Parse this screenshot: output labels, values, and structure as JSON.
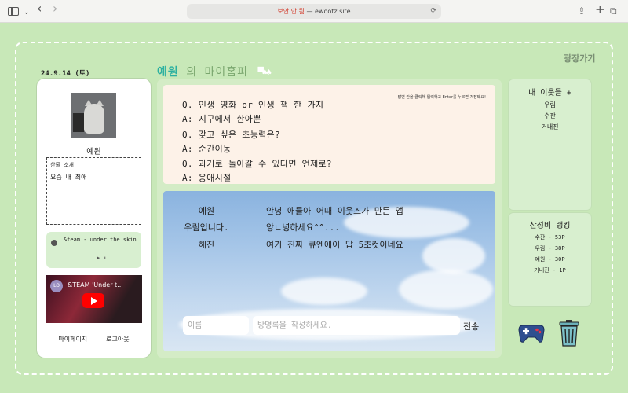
{
  "browser": {
    "url_warning": "보안 안 됨",
    "url_separator": " — ",
    "url_host": "ewootz.site",
    "back_glyph": "‹",
    "forward_glyph": "›",
    "share_glyph": "⇪",
    "new_tab_glyph": "+",
    "tabs_glyph": "⧉"
  },
  "header": {
    "date": "24.9.14 (토)",
    "owner": "예원",
    "title_suffix": " 의 마이홈피 ",
    "plaza_link": "광장가기"
  },
  "profile": {
    "name": "예원",
    "bio_label": "한줄 소개",
    "bio_text": "요즘 내 최애",
    "song": "&team - under the skin",
    "player_controls": "▶ ⏸",
    "video_channel": "LO",
    "video_title": "&TEAM 'Under t...",
    "mypage_link": "마이페이지",
    "logout_link": "로그아웃"
  },
  "qa": {
    "hint": "답변 칸을 클릭해 입력하고 Enter를 누르면 저장돼요!",
    "items": [
      {
        "q": "Q. 인생 영화 or 인생 책 한 가지",
        "a": "A: 지구에서 한아뿐"
      },
      {
        "q": "Q. 갖고 싶은 초능력은?",
        "a": "A: 순간이동"
      },
      {
        "q": "Q. 과거로 돌아갈 수 있다면 언제로?",
        "a": "A: 응애시절"
      }
    ]
  },
  "guestbook": {
    "entries": [
      {
        "who": "예원",
        "msg": "안녕 애들아 어때 이웃즈가 만든 앱"
      },
      {
        "who": "우림입니다.",
        "msg": "앙ㄴ녕하세요^^..."
      },
      {
        "who": "해진",
        "msg": "여기 진짜 큐엔에이 답 5초컷이네요"
      }
    ],
    "name_placeholder": "이름",
    "message_placeholder": "방명록을 작성하세요.",
    "send_label": "전송"
  },
  "friends": {
    "heading": "내 이웃들 +",
    "list": [
      "우림",
      "수잔",
      "거내진"
    ]
  },
  "ranking": {
    "heading": "산성비 랭킹",
    "list": [
      "수잔 - 53P",
      "우림 - 38P",
      "예원 - 30P",
      "거내진 - 1P"
    ]
  },
  "colors": {
    "background": "#c8e8b8",
    "owner_name": "#2bb0a0",
    "url_warning": "#d23c2c"
  },
  "icons": {
    "game": "gamepad-icon",
    "trash": "trash-can-icon"
  }
}
